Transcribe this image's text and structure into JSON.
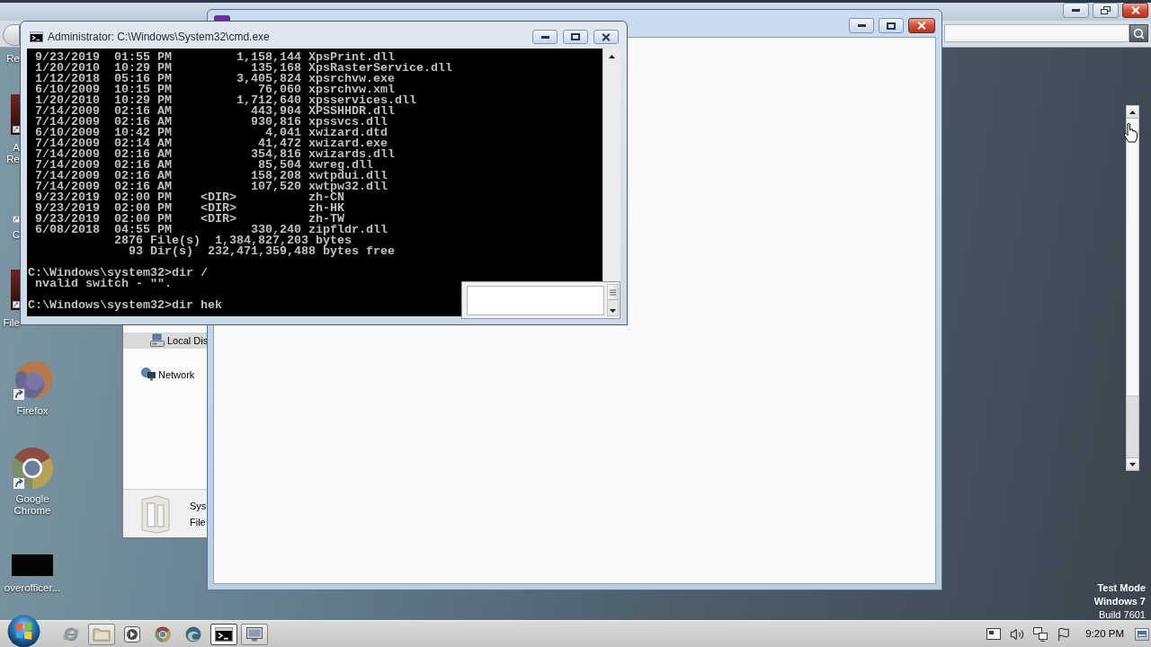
{
  "desktop": {
    "partly_hidden_icons": [
      {
        "kind": "hidden",
        "label": "Re"
      },
      {
        "kind": "app",
        "label": "A Re"
      },
      {
        "kind": "shortcut",
        "label": "C"
      },
      {
        "kind": "app",
        "label": "File"
      }
    ],
    "icons": [
      {
        "kind": "firefox",
        "label": "Firefox"
      },
      {
        "kind": "chrome",
        "label": "Google Chrome"
      },
      {
        "kind": "thumbnail",
        "label": "overofficer..."
      }
    ],
    "system_notice": [
      "Test Mode",
      "Windows 7",
      "Build 7601"
    ]
  },
  "explorer_window": {
    "nav_items": [
      {
        "kind": "disk",
        "label": "Local Dis",
        "selected": true
      },
      {
        "kind": "network",
        "label": "Network",
        "selected": false
      }
    ],
    "details": [
      "Sys",
      "File"
    ]
  },
  "cmd_window": {
    "title": "Administrator: C:\\Windows\\System32\\cmd.exe",
    "blocks": [
      [
        " 9/23/2019  01:55 PM         1,158,144 XpsPrint.dll",
        " 1/20/2010  10:29 PM           135,168 XpsRasterService.dll",
        " 1/12/2018  05:16 PM         3,405,824 xpsrchvw.exe",
        " 6/10/2009  10:15 PM            76,060 xpsrchvw.xml",
        " 1/20/2010  10:29 PM         1,712,640 xpsservices.dll",
        " 7/14/2009  02:16 AM           443,904 XPSSHHDR.dll",
        " 7/14/2009  02:16 AM           930,816 xpssvcs.dll",
        " 6/10/2009  10:42 PM             4,041 xwizard.dtd",
        " 7/14/2009  02:14 AM            41,472 xwizard.exe",
        " 7/14/2009  02:16 AM           354,816 xwizards.dll",
        " 7/14/2009  02:16 AM            85,504 xwreg.dll",
        " 7/14/2009  02:16 AM           158,208 xwtpdui.dll",
        " 7/14/2009  02:16 AM           107,520 xwtpw32.dll",
        " 9/23/2019  02:00 PM    <DIR>          zh-CN",
        " 9/23/2019  02:00 PM    <DIR>          zh-HK",
        " 9/23/2019  02:00 PM    <DIR>          zh-TW",
        " 6/08/2018  04:55 PM           330,240 zipfldr.dll",
        "            2876 File(s)  1,384,827,203 bytes",
        "              93 Dir(s)  232,471,359,488 bytes free"
      ],
      [
        "C:\\Windows\\system32>dir /",
        " nvalid switch - \"\"."
      ],
      [
        "C:\\Windows\\system32>dir hek"
      ]
    ]
  },
  "taskbar": {
    "apps": [
      {
        "kind": "ie",
        "running": false,
        "selected": false
      },
      {
        "kind": "explorer",
        "running": true,
        "selected": false
      },
      {
        "kind": "media",
        "running": false,
        "selected": false
      },
      {
        "kind": "chrome",
        "running": false,
        "selected": false
      },
      {
        "kind": "edge",
        "running": false,
        "selected": false
      },
      {
        "kind": "cmd",
        "running": true,
        "selected": true
      },
      {
        "kind": "remote",
        "running": true,
        "selected": false
      }
    ],
    "tray": [
      {
        "kind": "action-center"
      },
      {
        "kind": "volume"
      },
      {
        "kind": "network"
      },
      {
        "kind": "flag"
      }
    ],
    "clock": "9:20 PM"
  }
}
